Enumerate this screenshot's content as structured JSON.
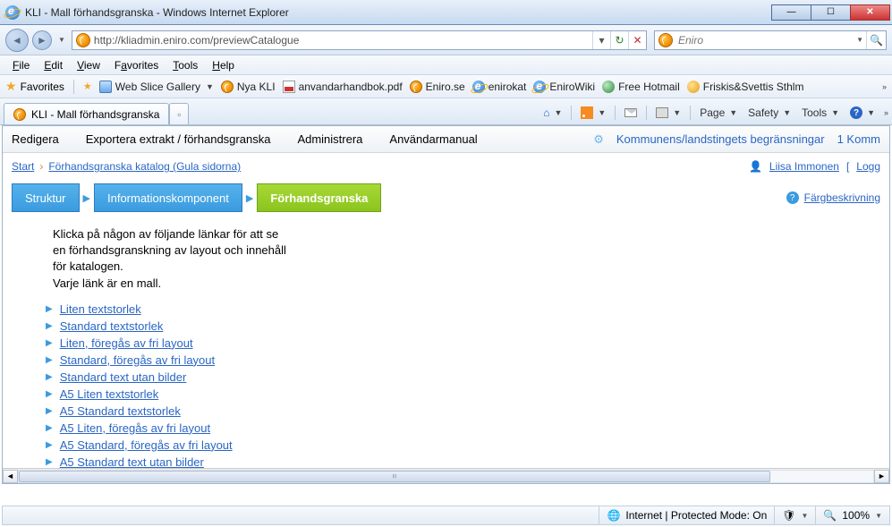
{
  "window": {
    "title": "KLI - Mall förhandsgranska - Windows Internet Explorer"
  },
  "nav": {
    "url": "http://kliadmin.eniro.com/previewCatalogue",
    "search_placeholder": "Eniro"
  },
  "menu": {
    "file": "File",
    "edit": "Edit",
    "view": "View",
    "favorites": "Favorites",
    "tools": "Tools",
    "help": "Help"
  },
  "favorites": {
    "label": "Favorites",
    "links": [
      {
        "name": "web-slice-gallery",
        "label": "Web Slice Gallery",
        "dropdown": true,
        "icon": "generic-ico"
      },
      {
        "name": "nya-kli",
        "label": "Nya KLI",
        "icon": "eniro-swirl"
      },
      {
        "name": "anvandarhandbok",
        "label": "anvandarhandbok.pdf",
        "icon": "pdf-ico"
      },
      {
        "name": "eniro-se",
        "label": "Eniro.se",
        "icon": "eniro-swirl"
      },
      {
        "name": "enirokat",
        "label": "enirokat",
        "icon": "ie-e"
      },
      {
        "name": "enirowiki",
        "label": "EniroWiki",
        "icon": "ie-e"
      },
      {
        "name": "free-hotmail",
        "label": "Free Hotmail",
        "icon": "globe-ico"
      },
      {
        "name": "friskis",
        "label": "Friskis&Svettis Sthlm",
        "icon": "fs-ico"
      }
    ]
  },
  "tab": {
    "title": "KLI - Mall förhandsgranska"
  },
  "cmd": {
    "page": "Page",
    "safety": "Safety",
    "tools": "Tools"
  },
  "app": {
    "menu": {
      "redigera": "Redigera",
      "exportera": "Exportera extrakt / förhandsgranska",
      "administrera": "Administrera",
      "manual": "Användarmanual",
      "begransningar": "Kommunens/landstingets begränsningar",
      "komm": "1 Komm"
    },
    "crumbs": {
      "start": "Start",
      "current": "Förhandsgranska katalog (Gula sidorna)",
      "user": "Liisa Immonen",
      "logout": "Logg"
    },
    "tabs": {
      "struktur": "Struktur",
      "info": "Informationskomponent",
      "forhand": "Förhandsgranska",
      "farg": "Färgbeskrivning"
    },
    "intro": {
      "line1": "Klicka på någon av följande länkar för att se",
      "line2": "en förhandsgranskning av layout och innehåll",
      "line3": "för katalogen.",
      "line4": "Varje länk är en mall."
    },
    "links": [
      "Liten textstorlek",
      "Standard textstorlek",
      "Liten, föregås av fri layout",
      "Standard, föregås av fri layout",
      "Standard text utan bilder",
      "A5 Liten textstorlek",
      "A5 Standard textstorlek",
      "A5 Liten, föregås av fri layout",
      "A5 Standard, föregås av fri layout",
      "A5 Standard text utan bilder"
    ]
  },
  "status": {
    "zone": "Internet | Protected Mode: On",
    "zoom": "100%"
  }
}
